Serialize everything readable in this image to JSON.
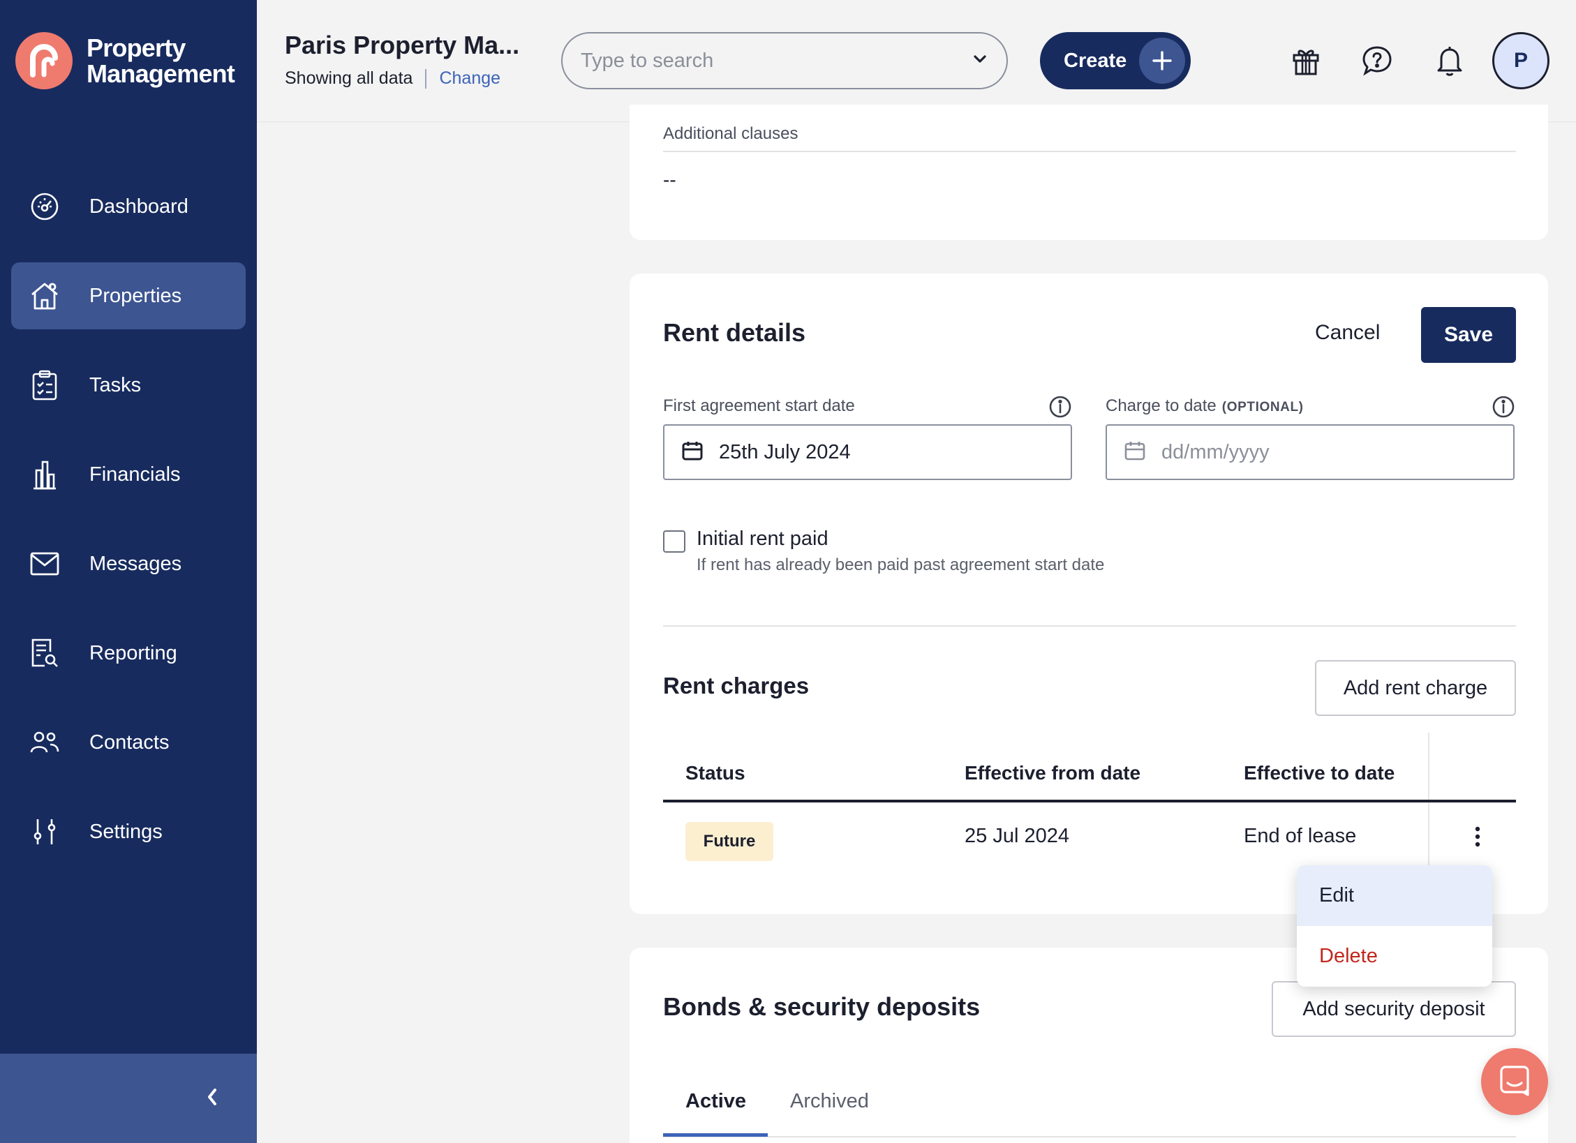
{
  "brand": {
    "line1": "Property",
    "line2": "Management",
    "accent": "#ef7a6e",
    "navy": "#172b5e"
  },
  "sidebar": {
    "items": [
      {
        "label": "Dashboard",
        "icon": "dashboard-icon",
        "active": false
      },
      {
        "label": "Properties",
        "icon": "house-icon",
        "active": true
      },
      {
        "label": "Tasks",
        "icon": "clipboard-icon",
        "active": false
      },
      {
        "label": "Financials",
        "icon": "bank-icon",
        "active": false
      },
      {
        "label": "Messages",
        "icon": "envelope-icon",
        "active": false
      },
      {
        "label": "Reporting",
        "icon": "report-search-icon",
        "active": false
      },
      {
        "label": "Contacts",
        "icon": "people-icon",
        "active": false
      },
      {
        "label": "Settings",
        "icon": "sliders-icon",
        "active": false
      }
    ]
  },
  "header": {
    "title": "Paris Property Ma...",
    "subtitle": "Showing all data",
    "change_link": "Change",
    "search_placeholder": "Type to search",
    "create_label": "Create",
    "avatar_initial": "P"
  },
  "clauses": {
    "label": "Additional clauses",
    "value": "--"
  },
  "rent_details": {
    "title": "Rent details",
    "cancel": "Cancel",
    "save": "Save",
    "start_label": "First agreement start date",
    "start_value": "25th July 2024",
    "charge_label": "Charge to date",
    "charge_optional": "(OPTIONAL)",
    "charge_placeholder": "dd/mm/yyyy",
    "initial_paid_label": "Initial rent paid",
    "initial_paid_help": "If rent has already been paid past agreement start date"
  },
  "rent_charges": {
    "title": "Rent charges",
    "add_button": "Add rent charge",
    "columns": [
      "Status",
      "Effective from date",
      "Effective to date"
    ],
    "rows": [
      {
        "status": "Future",
        "from": "25 Jul 2024",
        "to": "End of lease"
      }
    ],
    "menu": {
      "edit": "Edit",
      "delete": "Delete"
    }
  },
  "bonds": {
    "title": "Bonds & security deposits",
    "add_button": "Add security deposit",
    "tabs": [
      "Active",
      "Archived"
    ]
  }
}
